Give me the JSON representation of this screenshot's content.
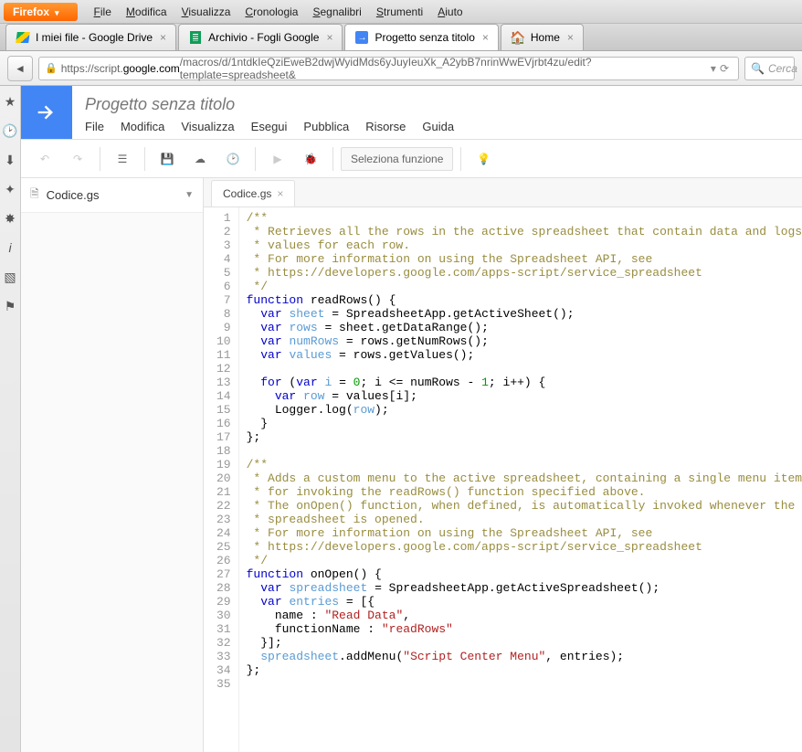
{
  "browser": {
    "app_button": "Firefox",
    "menus": [
      "File",
      "Modifica",
      "Visualizza",
      "Cronologia",
      "Segnalibri",
      "Strumenti",
      "Aiuto"
    ],
    "tabs": [
      {
        "label": "I miei file - Google Drive",
        "icon": "drive"
      },
      {
        "label": "Archivio - Fogli Google",
        "icon": "sheets"
      },
      {
        "label": "Progetto senza titolo",
        "icon": "script",
        "active": true
      },
      {
        "label": "Home",
        "icon": "home"
      }
    ],
    "url_prefix": "https://script.",
    "url_domain": "google.com",
    "url_path": "/macros/d/1ntdkIeQziEweB2dwjWyidMds6yJuyIeuXk_A2ybB7nrinWwEVjrbt4zu/edit?template=spreadsheet&",
    "search_placeholder": "Cerca"
  },
  "gas": {
    "title": "Progetto senza titolo",
    "menus": [
      "File",
      "Modifica",
      "Visualizza",
      "Esegui",
      "Pubblica",
      "Risorse",
      "Guida"
    ],
    "func_select": "Seleziona funzione",
    "files": [
      {
        "name": "Codice.gs"
      }
    ],
    "editor_tab": "Codice.gs"
  },
  "code": {
    "lines": [
      {
        "n": 1,
        "t": "comment",
        "s": "/**"
      },
      {
        "n": 2,
        "t": "comment",
        "s": " * Retrieves all the rows in the active spreadsheet that contain data and logs the"
      },
      {
        "n": 3,
        "t": "comment",
        "s": " * values for each row."
      },
      {
        "n": 4,
        "t": "comment",
        "s": " * For more information on using the Spreadsheet API, see"
      },
      {
        "n": 5,
        "t": "comment",
        "s": " * https://developers.google.com/apps-script/service_spreadsheet"
      },
      {
        "n": 6,
        "t": "comment",
        "s": " */"
      },
      {
        "n": 7,
        "t": "code",
        "html": "<span class='c-kw'>function</span> readRows() {"
      },
      {
        "n": 8,
        "t": "code",
        "html": "  <span class='c-kw'>var</span> <span class='c-var'>sheet</span> = SpreadsheetApp.getActiveSheet();"
      },
      {
        "n": 9,
        "t": "code",
        "html": "  <span class='c-kw'>var</span> <span class='c-var'>rows</span> = sheet.getDataRange();"
      },
      {
        "n": 10,
        "t": "code",
        "html": "  <span class='c-kw'>var</span> <span class='c-var'>numRows</span> = rows.getNumRows();"
      },
      {
        "n": 11,
        "t": "code",
        "html": "  <span class='c-kw'>var</span> <span class='c-var'>values</span> = rows.getValues();"
      },
      {
        "n": 12,
        "t": "code",
        "html": ""
      },
      {
        "n": 13,
        "t": "code",
        "html": "  <span class='c-kw'>for</span> (<span class='c-kw'>var</span> <span class='c-var'>i</span> = <span class='c-num'>0</span>; i &lt;= numRows - <span class='c-num'>1</span>; i++) {"
      },
      {
        "n": 14,
        "t": "code",
        "html": "    <span class='c-kw'>var</span> <span class='c-var'>row</span> = values[i];"
      },
      {
        "n": 15,
        "t": "code",
        "html": "    Logger.log(<span class='c-var'>row</span>);"
      },
      {
        "n": 16,
        "t": "code",
        "html": "  }"
      },
      {
        "n": 17,
        "t": "code",
        "html": "};"
      },
      {
        "n": 18,
        "t": "code",
        "html": ""
      },
      {
        "n": 19,
        "t": "comment",
        "s": "/**"
      },
      {
        "n": 20,
        "t": "comment",
        "s": " * Adds a custom menu to the active spreadsheet, containing a single menu item"
      },
      {
        "n": 21,
        "t": "comment",
        "s": " * for invoking the readRows() function specified above."
      },
      {
        "n": 22,
        "t": "comment",
        "s": " * The onOpen() function, when defined, is automatically invoked whenever the"
      },
      {
        "n": 23,
        "t": "comment",
        "s": " * spreadsheet is opened."
      },
      {
        "n": 24,
        "t": "comment",
        "s": " * For more information on using the Spreadsheet API, see"
      },
      {
        "n": 25,
        "t": "comment",
        "s": " * https://developers.google.com/apps-script/service_spreadsheet"
      },
      {
        "n": 26,
        "t": "comment",
        "s": " */"
      },
      {
        "n": 27,
        "t": "code",
        "html": "<span class='c-kw'>function</span> onOpen() {"
      },
      {
        "n": 28,
        "t": "code",
        "html": "  <span class='c-kw'>var</span> <span class='c-var'>spreadsheet</span> = SpreadsheetApp.getActiveSpreadsheet();"
      },
      {
        "n": 29,
        "t": "code",
        "html": "  <span class='c-kw'>var</span> <span class='c-var'>entries</span> = [{"
      },
      {
        "n": 30,
        "t": "code",
        "html": "    name : <span class='c-str'>\"Read Data\"</span>,"
      },
      {
        "n": 31,
        "t": "code",
        "html": "    functionName : <span class='c-str'>\"readRows\"</span>"
      },
      {
        "n": 32,
        "t": "code",
        "html": "  }];"
      },
      {
        "n": 33,
        "t": "code",
        "html": "  <span class='c-var'>spreadsheet</span>.addMenu(<span class='c-str'>\"Script Center Menu\"</span>, entries);"
      },
      {
        "n": 34,
        "t": "code",
        "html": "};"
      },
      {
        "n": 35,
        "t": "code",
        "html": ""
      }
    ]
  }
}
